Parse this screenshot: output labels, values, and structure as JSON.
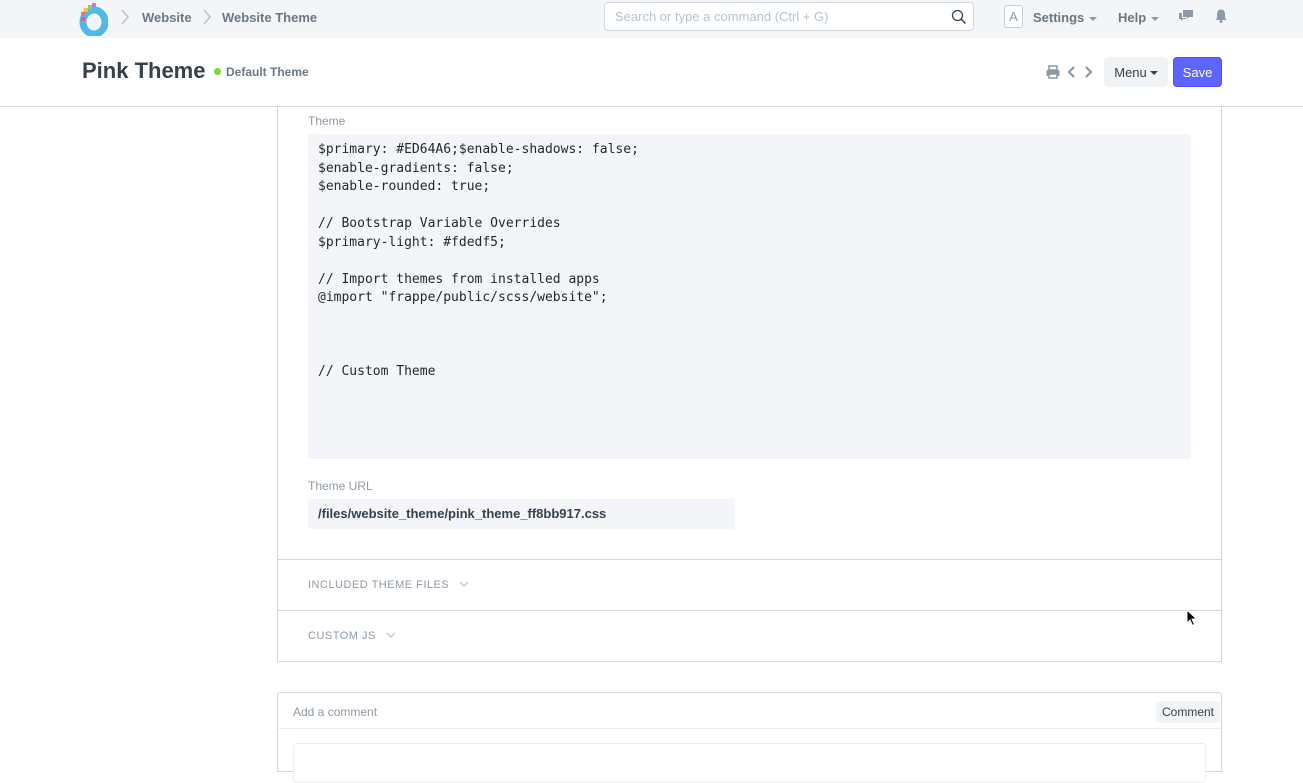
{
  "navbar": {
    "breadcrumbs": [
      "Website",
      "Website Theme"
    ],
    "search_placeholder": "Search or type a command (Ctrl + G)",
    "avatar_initial": "A",
    "settings_label": "Settings",
    "help_label": "Help"
  },
  "header": {
    "title": "Pink Theme",
    "status": "Default Theme",
    "status_color": "#7cd63a",
    "menu_label": "Menu",
    "save_label": "Save",
    "accent_color": "#5e64ff"
  },
  "form": {
    "theme_label": "Theme",
    "theme_code": "$primary: #ED64A6;$enable-shadows: false;\n$enable-gradients: false;\n$enable-rounded: true;\n\n// Bootstrap Variable Overrides\n$primary-light: #fdedf5;\n\n// Import themes from installed apps\n@import \"frappe/public/scss/website\";\n\n\n\n// Custom Theme",
    "theme_url_label": "Theme URL",
    "theme_url_value": "/files/website_theme/pink_theme_ff8bb917.css",
    "sections": [
      {
        "label": "INCLUDED THEME FILES"
      },
      {
        "label": "CUSTOM JS"
      }
    ]
  },
  "comments": {
    "placeholder": "Add a comment",
    "button_label": "Comment"
  }
}
